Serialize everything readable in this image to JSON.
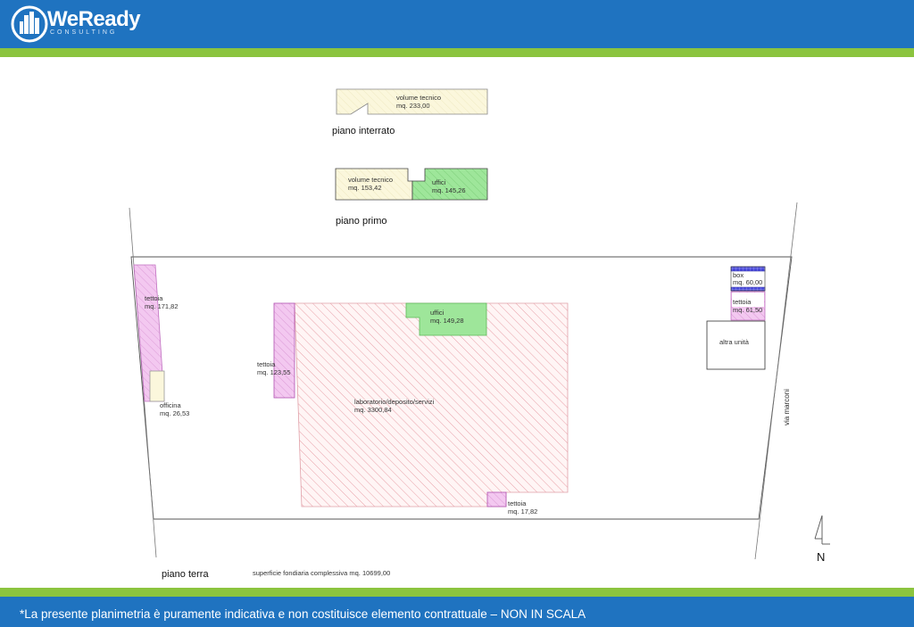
{
  "header": {
    "brand_name": "WeReady",
    "brand_sub": "CONSULTING"
  },
  "footer": {
    "disclaimer": "*La presente planimetria è puramente indicativa e non costituisce elemento contrattuale – NON IN SCALA"
  },
  "plan": {
    "floor_labels": {
      "basement": "piano interrato",
      "first": "piano primo",
      "ground": "piano terra"
    },
    "rooms": {
      "volume_tecnico_basement": {
        "name": "volume tecnico",
        "area": "mq. 233,00"
      },
      "volume_tecnico_first": {
        "name": "volume tecnico",
        "area": "mq. 153,42"
      },
      "uffici_first": {
        "name": "uffici",
        "area": "mq. 145,26"
      },
      "tettoia_left": {
        "name": "tettoia",
        "area": "mq. 171,82"
      },
      "officina": {
        "name": "officina",
        "area": "mq. 26,53"
      },
      "tettoia_mid": {
        "name": "tettoia",
        "area": "mq. 123,55"
      },
      "uffici_ground": {
        "name": "uffici",
        "area": "mq. 149,28"
      },
      "laboratorio": {
        "name": "laboratorio/deposito/servizi",
        "area": "mq. 3300,84"
      },
      "tettoia_small": {
        "name": "tettoia",
        "area": "mq. 17,82"
      },
      "box": {
        "name": "box",
        "area": "mq. 60,00"
      },
      "tettoia_right": {
        "name": "tettoia",
        "area": "mq. 61,50"
      },
      "altra_unita": {
        "name": "altra unità"
      }
    },
    "street_label": "via marconi",
    "total_surface": "superficie fondiaria complessiva mq. 10699,00",
    "north_label": "N"
  },
  "colors": {
    "header_blue": "#1f73c0",
    "accent_green": "#8bc43f",
    "lab_hatch": "#e8a0a8",
    "tettoia_fill": "#f3c8f0",
    "uffici_fill": "#9ee69a",
    "volume_fill": "#fbf7dc",
    "box_fill": "#4a4ad8"
  }
}
